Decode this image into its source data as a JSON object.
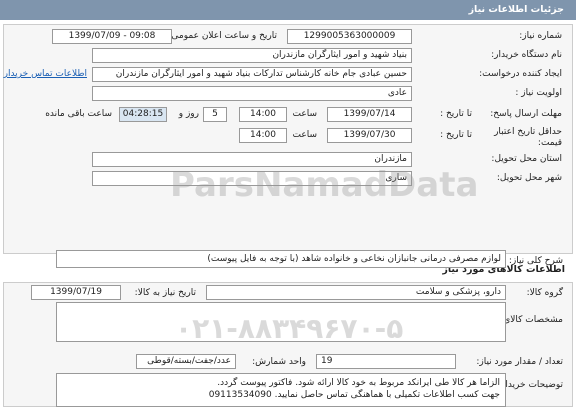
{
  "header": {
    "title": "جزئیات اطلاعات نیاز"
  },
  "fields": {
    "need_number_label": "شماره نیاز:",
    "need_number": "1299005363000009",
    "announce_label": "تاریخ و ساعت اعلان عمومی:",
    "announce_value": "1399/07/09 - 09:08",
    "buyer_label": "نام دستگاه خریدار:",
    "buyer_value": "بنیاد شهید و امور ایثارگران مازندران",
    "requester_label": "ایجاد کننده درخواست:",
    "requester_value": "حسین عبادی جام خانه کارشناس تدارکات بنیاد شهید و امور ایثارگران مازندران",
    "contact_link": "اطلاعات تماس خریدار",
    "priority_label": "اولویت نیاز :",
    "priority_value": "عادی",
    "deadline_label": "مهلت ارسال پاسخ:",
    "deadline_until": "تا تاریخ :",
    "deadline_date": "1399/07/14",
    "time_label": "ساعت",
    "deadline_time": "14:00",
    "remaining_days": "5",
    "days_word": "روز و",
    "remaining_time": "04:28:15",
    "remaining_suffix": "ساعت باقی مانده",
    "validity_label_1": "حداقل تاریخ اعتبار",
    "validity_label_2": "قیمت:",
    "validity_until": "تا تاریخ :",
    "validity_date": "1399/07/30",
    "validity_time_label": "ساعت",
    "validity_time": "14:00",
    "province_label": "استان محل تحویل:",
    "province_value": "مازندران",
    "city_label": "شهر محل تحویل:",
    "city_value": "ساری"
  },
  "goods": {
    "section_title": "اطلاعات کالاهای مورد نیاز",
    "summary_label": "شرح کلی نیاز:",
    "summary_value": "لوازم مصرفی درمانی جانبازان نخاعی و خانواده شاهد (با توجه به فایل پیوست)",
    "group_label": "گروه کالا:",
    "group_value": "دارو، پزشکی و سلامت",
    "need_date_label": "تاریخ نیاز به کالا:",
    "need_date_value": "1399/07/19",
    "specs_label": "مشخصات کالای مورد نیاز:",
    "qty_label": "تعداد / مقدار مورد نیاز:",
    "qty_value": "19",
    "unit_label": "واحد شمارش:",
    "unit_value": "عدد/جفت/بسته/قوطی",
    "buyer_notes_label": "توضیحات خریدار:",
    "buyer_notes_line1": "الزاما هر کالا طی ایرانکد مربوط به خود کالا ارائه شود. فاکتور پیوست گردد.",
    "buyer_notes_line2": "جهت کسب اطلاعات تکمیلی با هماهنگی تماس حاصل نمایید.  09113534090"
  },
  "watermark": {
    "brand": "ParsNamadData",
    "phone": "۰۲۱-۸۸۳۴۹۶۷۰-۵"
  }
}
